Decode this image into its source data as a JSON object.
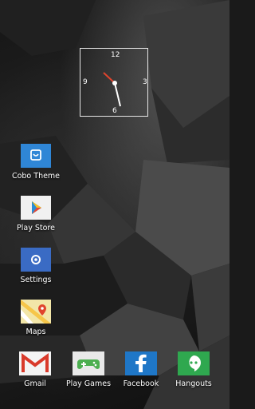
{
  "clock": {
    "n12": "12",
    "n3": "3",
    "n6": "6",
    "n9": "9"
  },
  "apps": [
    {
      "label": "Cobo Theme",
      "icon": "cobo-theme-icon"
    },
    {
      "label": "Play Store",
      "icon": "play-store-icon"
    },
    {
      "label": "Settings",
      "icon": "settings-icon"
    },
    {
      "label": "Maps",
      "icon": "maps-icon"
    }
  ],
  "dock": [
    {
      "label": "Gmail",
      "icon": "gmail-icon"
    },
    {
      "label": "Play Games",
      "icon": "play-games-icon"
    },
    {
      "label": "Facebook",
      "icon": "facebook-icon"
    },
    {
      "label": "Hangouts",
      "icon": "hangouts-icon"
    }
  ],
  "colors": {
    "cobo": "#2f86d6",
    "settings": "#3a6bc4",
    "facebook": "#1f77c7",
    "hangouts": "#2fa84f",
    "clock_hour_hand": "#e0442d"
  }
}
